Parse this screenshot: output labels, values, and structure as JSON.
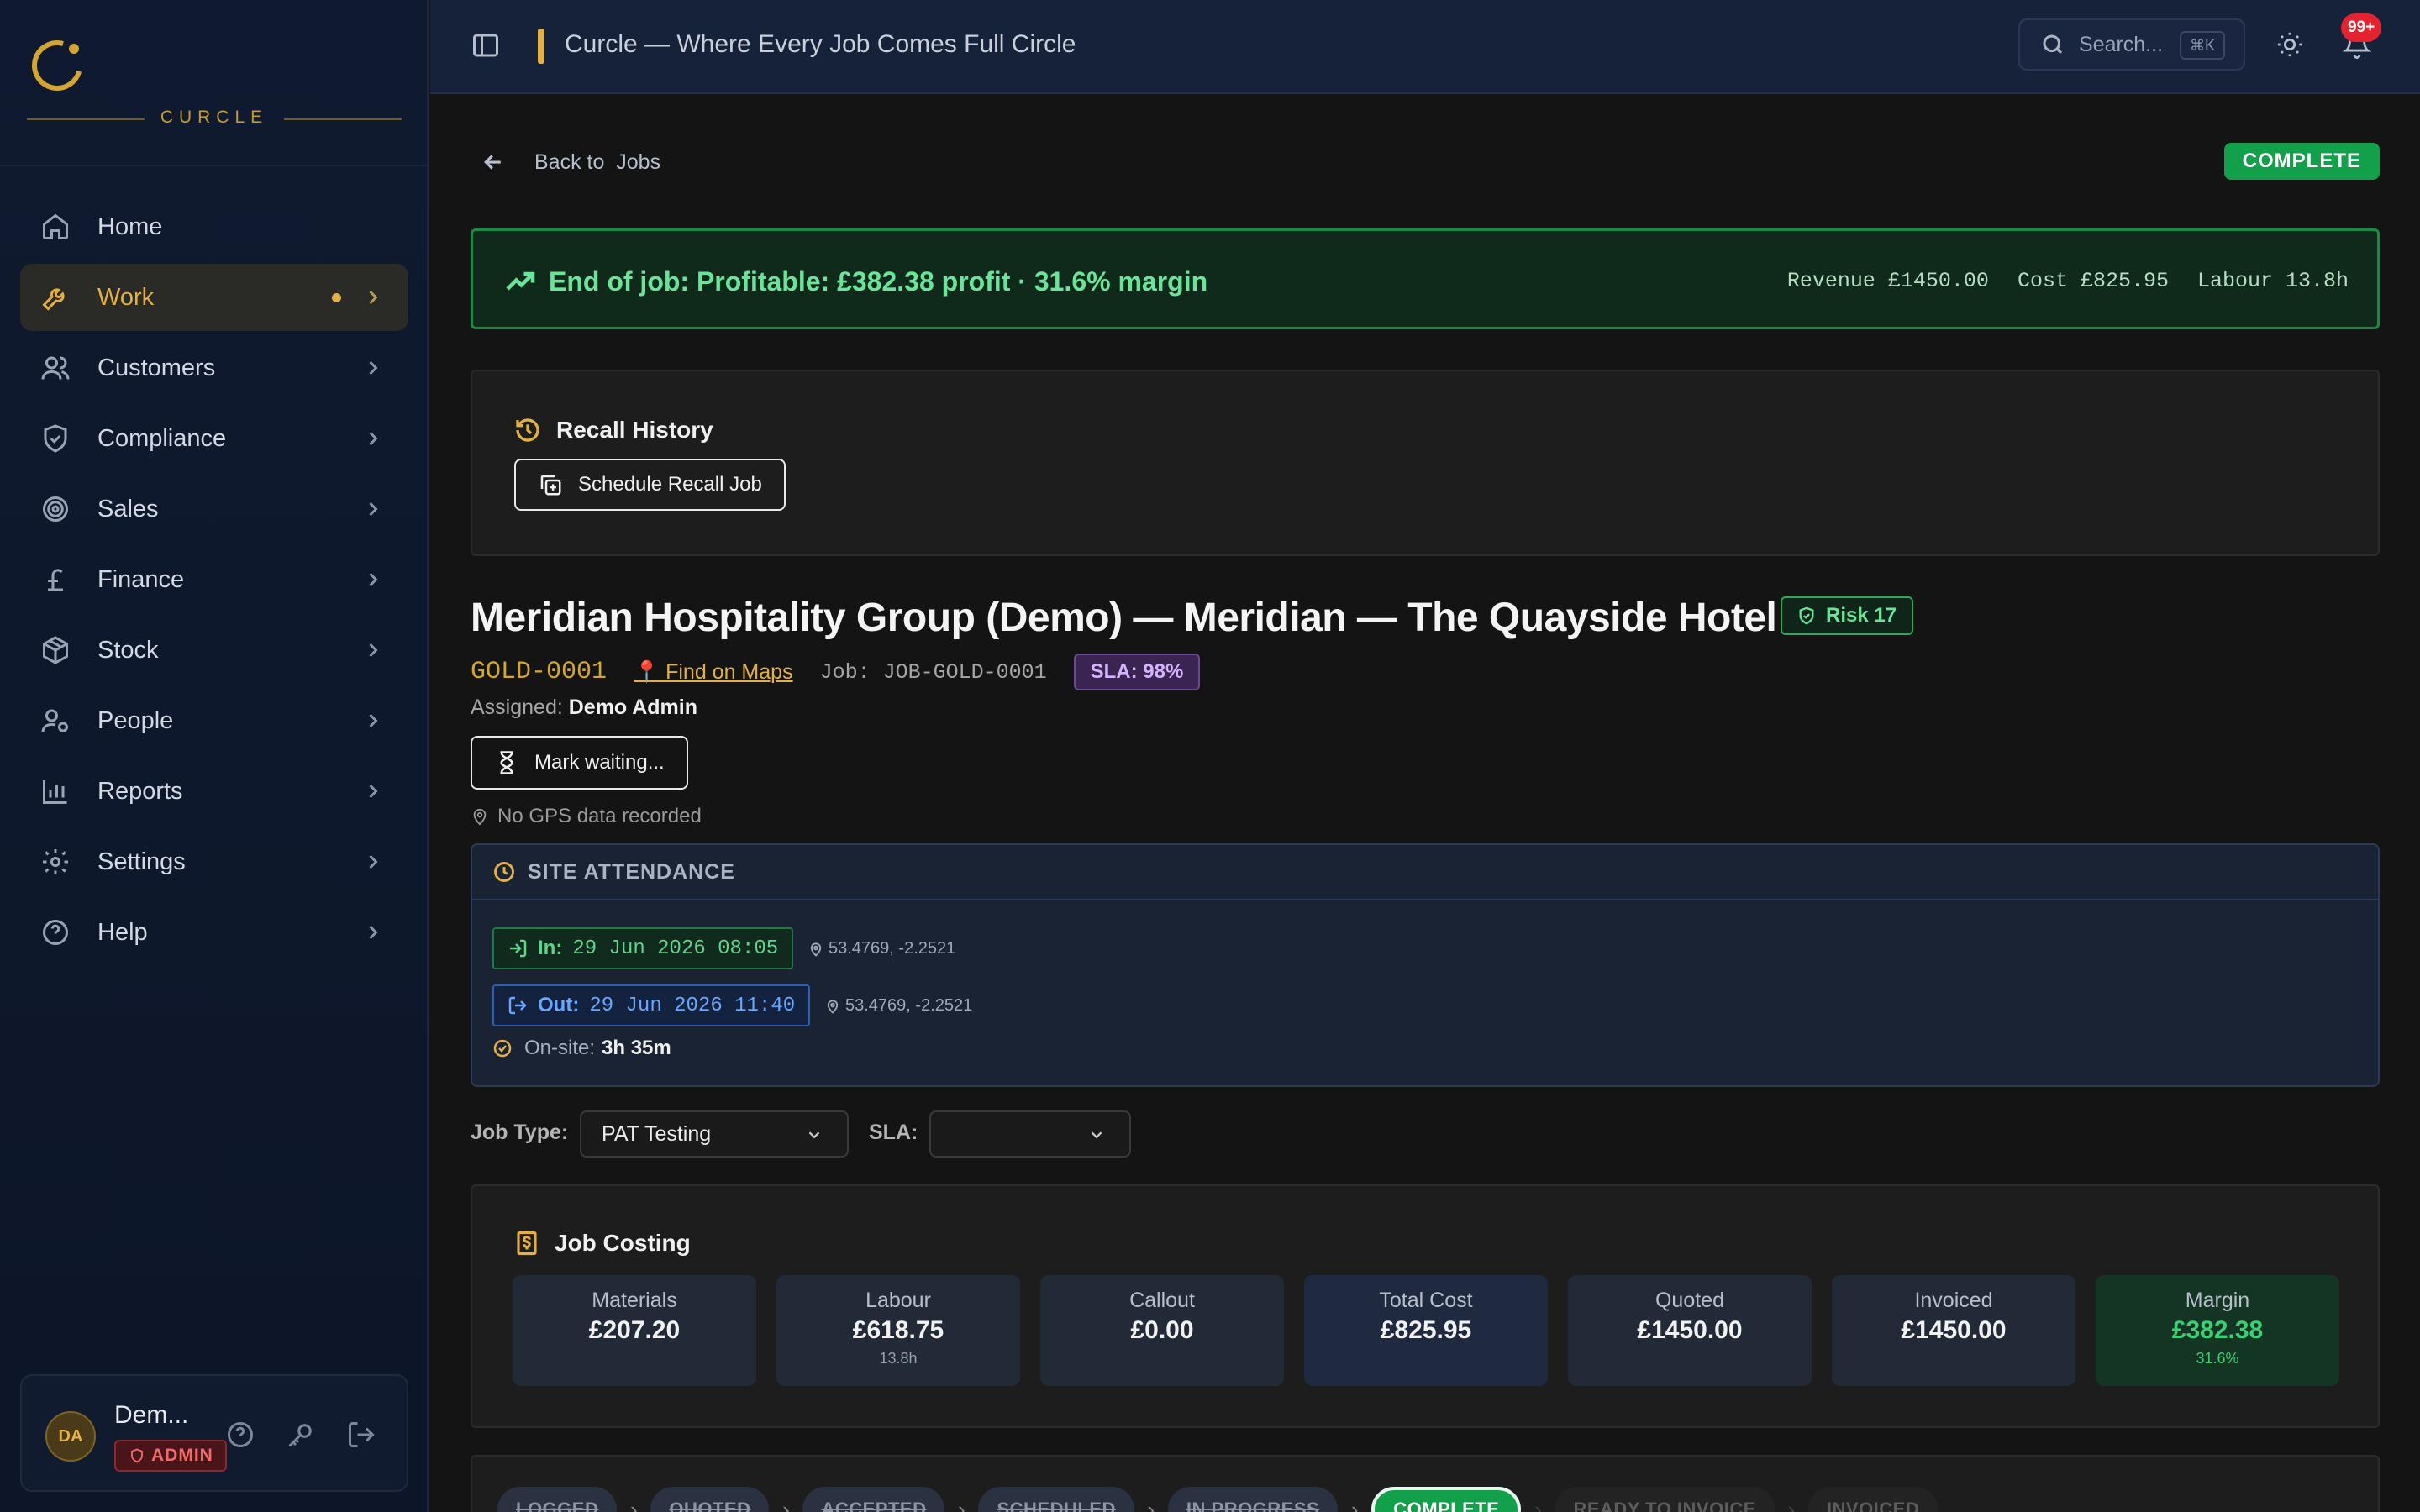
{
  "brand": {
    "name": "CURCLE",
    "accent": "#d4a531"
  },
  "sidebar": {
    "items": [
      {
        "label": "Home",
        "icon": "home-icon",
        "chevron": false
      },
      {
        "label": "Work",
        "icon": "wrench-icon",
        "chevron": true,
        "active": true,
        "dot": true
      },
      {
        "label": "Customers",
        "icon": "users-icon",
        "chevron": true
      },
      {
        "label": "Compliance",
        "icon": "shield-check-icon",
        "chevron": true
      },
      {
        "label": "Sales",
        "icon": "target-icon",
        "chevron": true
      },
      {
        "label": "Finance",
        "icon": "pound-icon",
        "chevron": true
      },
      {
        "label": "Stock",
        "icon": "package-icon",
        "chevron": true
      },
      {
        "label": "People",
        "icon": "user-cog-icon",
        "chevron": true
      },
      {
        "label": "Reports",
        "icon": "bar-chart-icon",
        "chevron": true
      },
      {
        "label": "Settings",
        "icon": "gear-icon",
        "chevron": true
      },
      {
        "label": "Help",
        "icon": "help-circle-icon",
        "chevron": true
      }
    ],
    "user": {
      "initials": "DA",
      "name": "Dem...",
      "role": "ADMIN"
    }
  },
  "topbar": {
    "title": "Curcle — Where Every Job Comes Full Circle",
    "search_placeholder": "Search...",
    "search_shortcut": "⌘K",
    "notifications": "99+"
  },
  "job": {
    "back_label": "Back to",
    "back_target": "Jobs",
    "status": "COMPLETE",
    "profit": {
      "text": "End of job: Profitable: £382.38 profit · 31.6% margin",
      "revenue": "Revenue £1450.00",
      "cost": "Cost £825.95",
      "labour": "Labour 13.8h"
    },
    "recall": {
      "title": "Recall History",
      "button": "Schedule Recall Job"
    },
    "title": "Meridian Hospitality Group (Demo) — Meridian — The Quayside Hotel",
    "risk": "Risk 17",
    "code": "GOLD-0001",
    "maps_link": "📍 Find on Maps",
    "job_ref": "Job: JOB-GOLD-0001",
    "sla_badge": "SLA: 98%",
    "assigned_label": "Assigned:",
    "assigned_name": "Demo Admin",
    "mark_waiting": "Mark waiting...",
    "gps_note": "No GPS data recorded"
  },
  "attendance": {
    "title": "SITE ATTENDANCE",
    "in_label": "In:",
    "in_time": "29 Jun 2026 08:05",
    "in_coord": "53.4769, -2.2521",
    "out_label": "Out:",
    "out_time": "29 Jun 2026 11:40",
    "out_coord": "53.4769, -2.2521",
    "onsite_label": "On-site:",
    "onsite_value": "3h 35m"
  },
  "fields": {
    "job_type_label": "Job Type:",
    "job_type_value": "PAT Testing",
    "sla_label": "SLA:",
    "sla_value": ""
  },
  "costing": {
    "title": "Job Costing",
    "tiles": [
      {
        "label": "Materials",
        "value": "£207.20",
        "sub": ""
      },
      {
        "label": "Labour",
        "value": "£618.75",
        "sub": "13.8h"
      },
      {
        "label": "Callout",
        "value": "£0.00",
        "sub": ""
      },
      {
        "label": "Total Cost",
        "value": "£825.95",
        "sub": ""
      },
      {
        "label": "Quoted",
        "value": "£1450.00",
        "sub": ""
      },
      {
        "label": "Invoiced",
        "value": "£1450.00",
        "sub": ""
      },
      {
        "label": "Margin",
        "value": "£382.38",
        "sub": "31.6%"
      }
    ]
  },
  "pipeline": {
    "steps": [
      "LOGGED",
      "QUOTED",
      "ACCEPTED",
      "SCHEDULED",
      "IN PROGRESS",
      "COMPLETE",
      "READY TO INVOICE",
      "INVOICED"
    ]
  }
}
